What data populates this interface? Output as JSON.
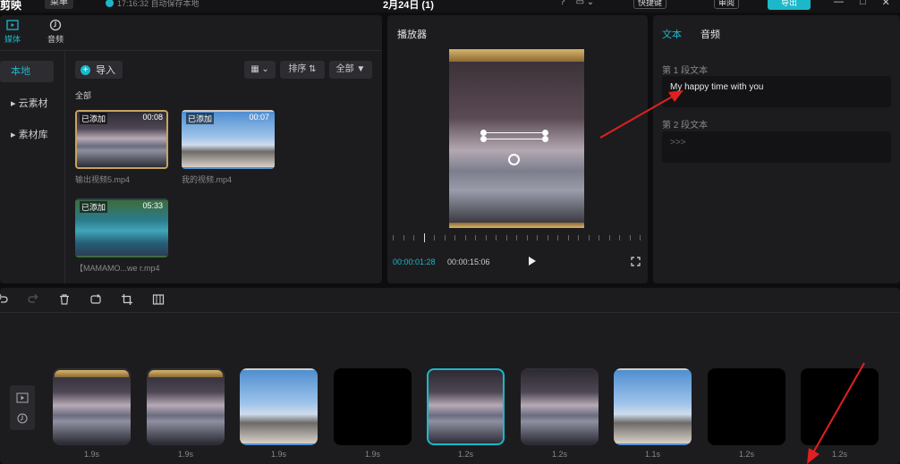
{
  "app": {
    "title": "剪映",
    "menu_label": "菜单",
    "save_status": "17:16:32 自动保存本地",
    "project_name": "2月24日 (1)",
    "shortcut_label": "快捷键",
    "review_label": "审阅",
    "export_label": "导出",
    "accent_color": "#1bb8c9"
  },
  "media_panel": {
    "tabs": [
      {
        "label": "媒体",
        "icon": "media-icon",
        "active": true
      },
      {
        "label": "音频",
        "icon": "audio-icon",
        "active": false
      }
    ],
    "sidebar": [
      {
        "label": "本地",
        "active": true
      },
      {
        "label": "▸ 云素材",
        "active": false
      },
      {
        "label": "▸ 素材库",
        "active": false
      }
    ],
    "import_label": "导入",
    "view_toggle_label": "▦ ⌄",
    "sort_label": "排序 ⇅",
    "filter_label": "全部 ▼",
    "section_label": "全部",
    "items": [
      {
        "name": "输出视频5.mp4",
        "badge": "已添加",
        "duration": "00:08",
        "selected": true
      },
      {
        "name": "我的视频.mp4",
        "badge": "已添加",
        "duration": "00:07",
        "selected": false
      },
      {
        "name": "【MAMAMO...we r.mp4",
        "badge": "已添加",
        "duration": "05:33",
        "selected": false
      }
    ]
  },
  "player": {
    "title": "播放器",
    "current_time": "00:00:01:28",
    "total_time": "00:00:15:06"
  },
  "text_panel": {
    "tabs": [
      {
        "label": "文本",
        "active": true
      },
      {
        "label": "音频",
        "active": false
      }
    ],
    "paragraphs": [
      {
        "label": "第 1 段文本",
        "value": "My happy time with you"
      },
      {
        "label": "第 2 段文本",
        "value": ">>>"
      }
    ]
  },
  "timeline": {
    "clips": [
      {
        "duration": "1.9s",
        "image": "sunset",
        "gold": true,
        "active": false
      },
      {
        "duration": "1.9s",
        "image": "sunset",
        "gold": true,
        "active": false
      },
      {
        "duration": "1.9s",
        "image": "sky",
        "gold": false,
        "active": false
      },
      {
        "duration": "1.9s",
        "image": "black",
        "gold": false,
        "active": false
      },
      {
        "duration": "1.2s",
        "image": "sunset",
        "gold": false,
        "active": true
      },
      {
        "duration": "1.2s",
        "image": "sunset",
        "gold": false,
        "active": false
      },
      {
        "duration": "1.1s",
        "image": "sky",
        "gold": false,
        "active": false
      },
      {
        "duration": "1.2s",
        "image": "black",
        "gold": false,
        "active": false
      },
      {
        "duration": "1.2s",
        "image": "black",
        "gold": false,
        "active": false
      }
    ]
  }
}
